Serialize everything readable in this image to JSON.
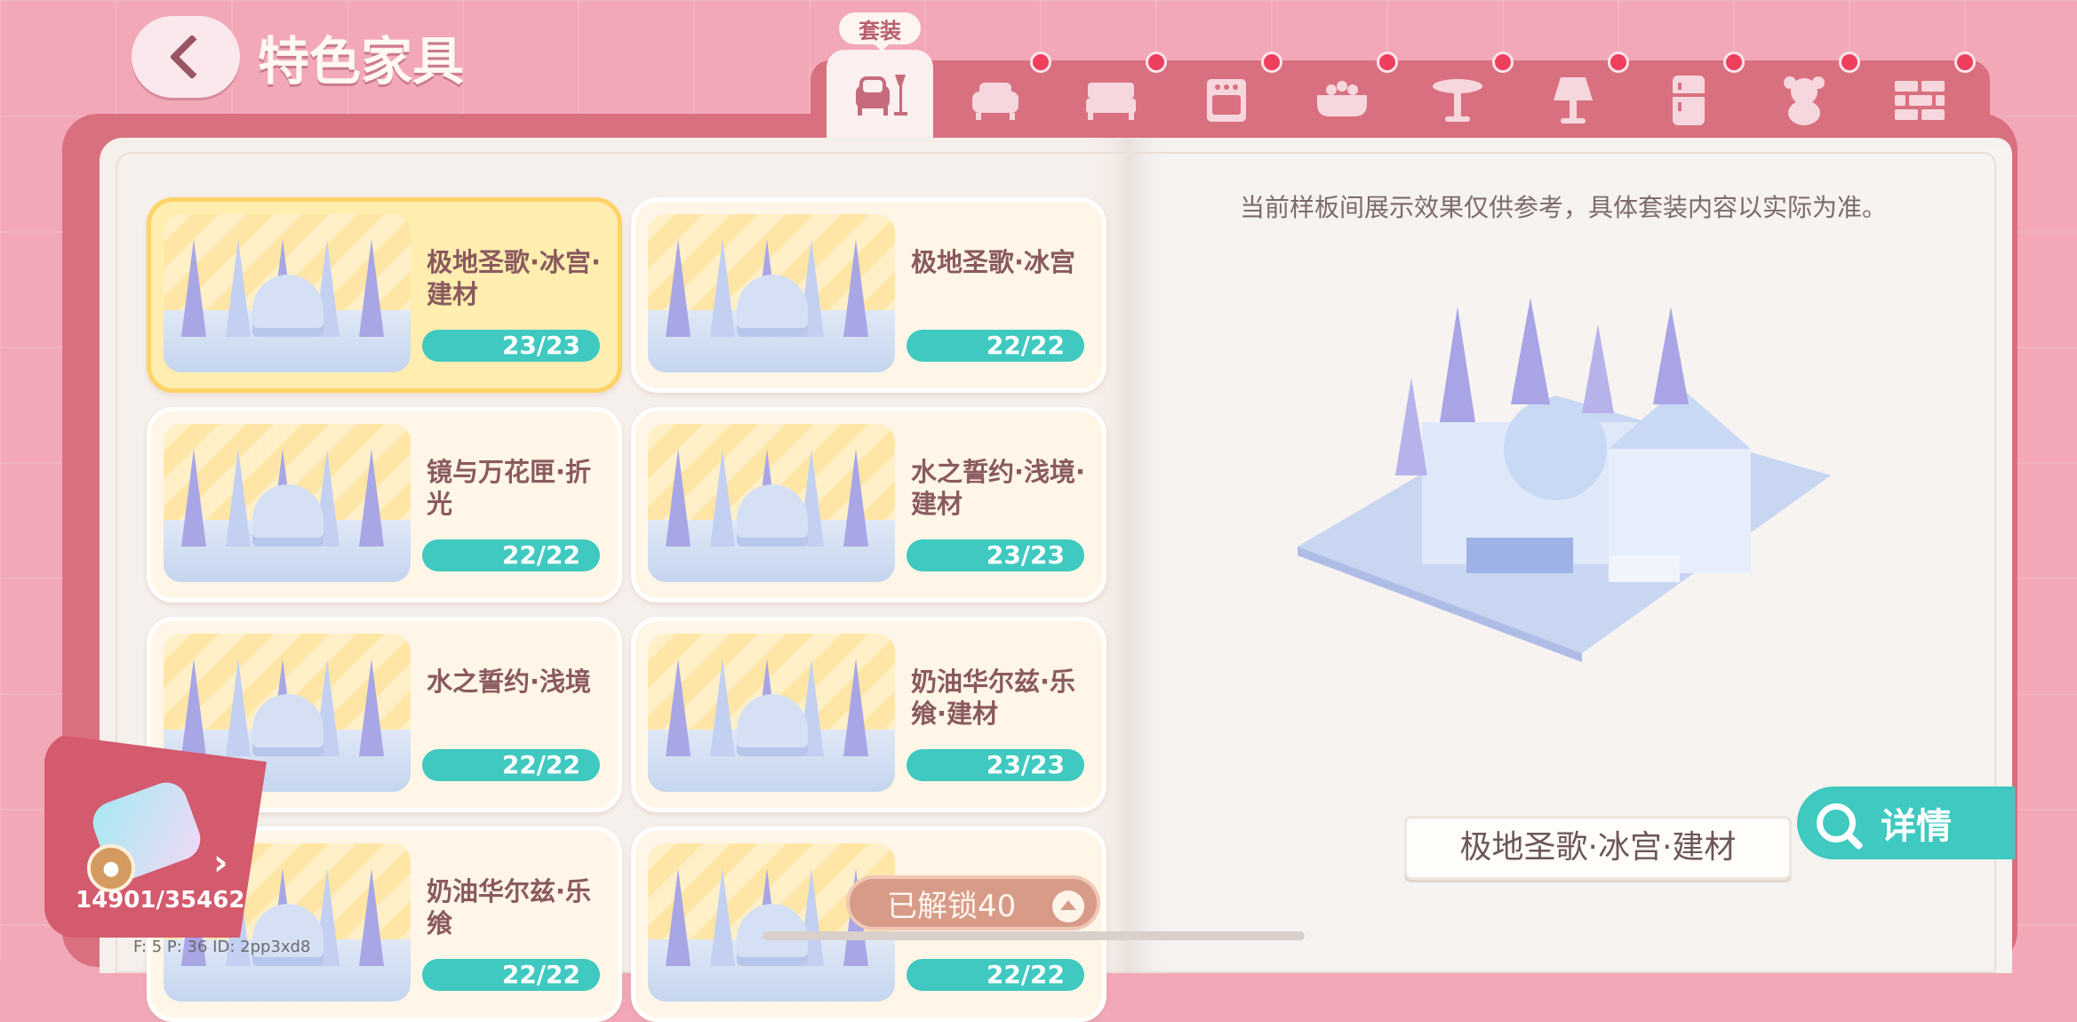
{
  "header": {
    "title": "特色家具"
  },
  "tabs": {
    "active_label": "套装",
    "items": [
      {
        "icon": "armchair-lamp-icon",
        "active": true
      },
      {
        "icon": "sofa-icon"
      },
      {
        "icon": "bed-icon"
      },
      {
        "icon": "stove-icon"
      },
      {
        "icon": "bathtub-icon"
      },
      {
        "icon": "round-table-icon"
      },
      {
        "icon": "lamp-icon"
      },
      {
        "icon": "fridge-icon"
      },
      {
        "icon": "teddy-bear-icon"
      },
      {
        "icon": "brick-wall-icon"
      }
    ]
  },
  "sets": [
    {
      "title": "极地圣歌·冰宫·建材",
      "count": "23/23",
      "selected": true
    },
    {
      "title": "极地圣歌·冰宫",
      "count": "22/22"
    },
    {
      "title": "镜与万花匣·折光",
      "count": "22/22"
    },
    {
      "title": "水之誓约·浅境·建材",
      "count": "23/23"
    },
    {
      "title": "水之誓约·浅境",
      "count": "22/22"
    },
    {
      "title": "奶油华尔兹·乐飨·建材",
      "count": "23/23"
    },
    {
      "title": "奶油华尔兹·乐飨",
      "count": "22/22"
    },
    {
      "title": "",
      "count": "22/22"
    }
  ],
  "preview": {
    "notice": "当前样板间展示效果仅供参考，具体套装内容以实际为准。",
    "set_name": "极地圣歌·冰宫·建材",
    "detail_label": "详情"
  },
  "collection": {
    "count": "14901/35462"
  },
  "unlock": {
    "label": "已解锁40"
  },
  "debug": {
    "text": "F: 5    P: 36    ID: 2pp3xd8"
  },
  "colors": {
    "accent": "#3fc9c0",
    "page_bg": "#f2a8b7",
    "book": "#d9707f",
    "selected": "#ffd366"
  }
}
